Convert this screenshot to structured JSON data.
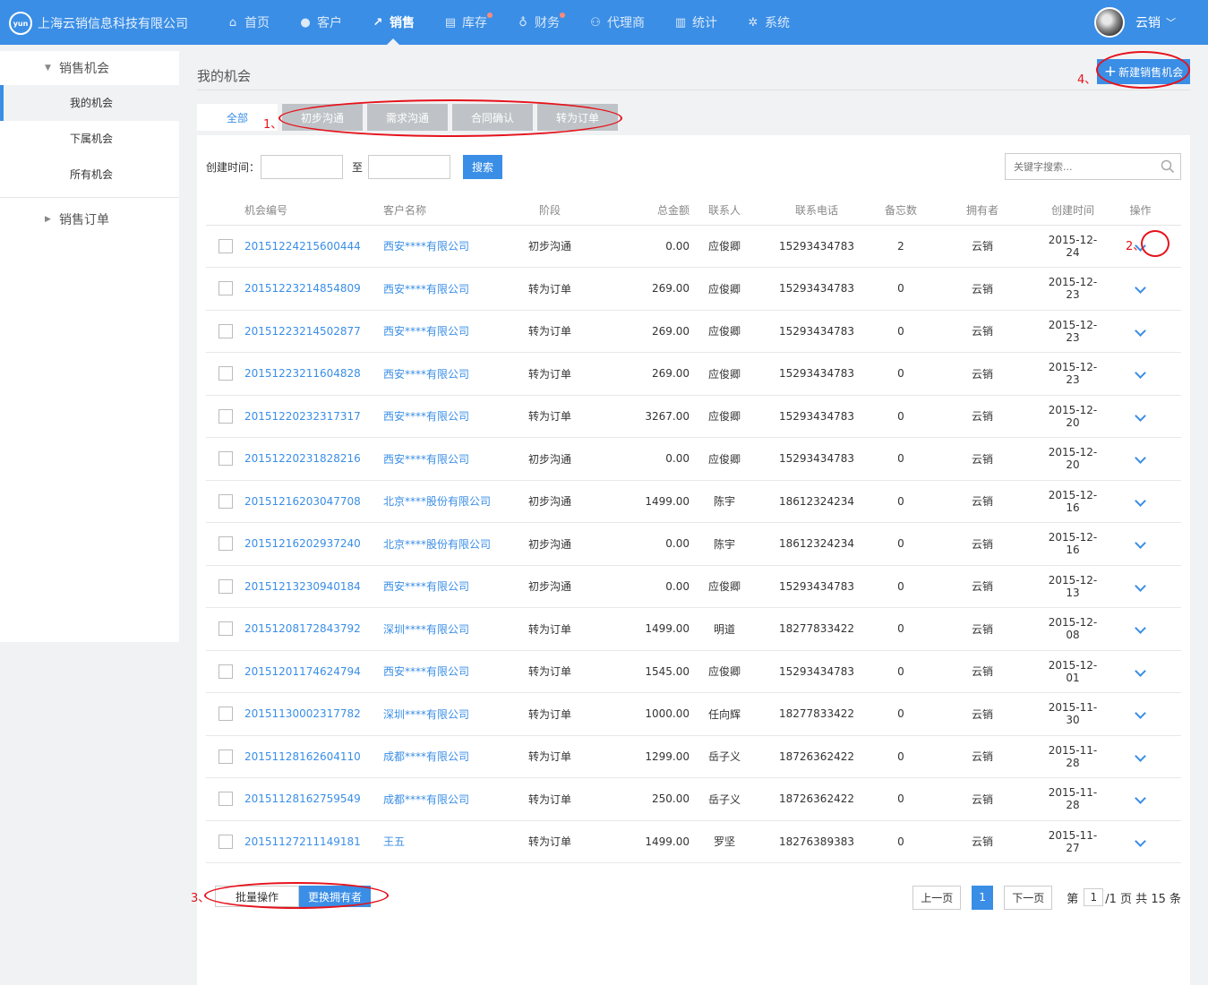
{
  "brand": {
    "logo": "yun",
    "name": "上海云销信息科技有限公司"
  },
  "nav": [
    {
      "label": "首页",
      "icon": "home-icon",
      "glyph": "⌂",
      "active": false,
      "dot": false
    },
    {
      "label": "客户",
      "icon": "person-icon",
      "glyph": "●",
      "active": false,
      "dot": false
    },
    {
      "label": "销售",
      "icon": "chart-icon",
      "glyph": "↗",
      "active": true,
      "dot": false
    },
    {
      "label": "库存",
      "icon": "warehouse-icon",
      "glyph": "▤",
      "active": false,
      "dot": true
    },
    {
      "label": "财务",
      "icon": "money-bag-icon",
      "glyph": "♁",
      "active": false,
      "dot": true
    },
    {
      "label": "代理商",
      "icon": "people-icon",
      "glyph": "⚇",
      "active": false,
      "dot": false
    },
    {
      "label": "统计",
      "icon": "bar-chart-icon",
      "glyph": "▥",
      "active": false,
      "dot": false
    },
    {
      "label": "系统",
      "icon": "gear-icon",
      "glyph": "✲",
      "active": false,
      "dot": false
    }
  ],
  "user": {
    "name": "云销"
  },
  "sidebar": {
    "group1": "销售机会",
    "items": [
      "我的机会",
      "下属机会",
      "所有机会"
    ],
    "group2": "销售订单"
  },
  "main": {
    "title": "我的机会",
    "new_button": "新建销售机会",
    "tabs": [
      "全部",
      "初步沟通",
      "需求沟通",
      "合同确认",
      "转为订单"
    ],
    "filter_label": "创建时间：",
    "to_label": "至",
    "search_button": "搜索",
    "keyword_placeholder": "关键字搜索..."
  },
  "table": {
    "headers": [
      "机会编号",
      "客户名称",
      "阶段",
      "总金额",
      "联系人",
      "联系电话",
      "备忘数",
      "拥有者",
      "创建时间",
      "操作"
    ],
    "rows": [
      [
        "20151224215600444",
        "西安****有限公司",
        "初步沟通",
        "0.00",
        "应俊卿",
        "15293434783",
        "2",
        "云销",
        "2015-12-24"
      ],
      [
        "20151223214854809",
        "西安****有限公司",
        "转为订单",
        "269.00",
        "应俊卿",
        "15293434783",
        "0",
        "云销",
        "2015-12-23"
      ],
      [
        "20151223214502877",
        "西安****有限公司",
        "转为订单",
        "269.00",
        "应俊卿",
        "15293434783",
        "0",
        "云销",
        "2015-12-23"
      ],
      [
        "20151223211604828",
        "西安****有限公司",
        "转为订单",
        "269.00",
        "应俊卿",
        "15293434783",
        "0",
        "云销",
        "2015-12-23"
      ],
      [
        "20151220232317317",
        "西安****有限公司",
        "转为订单",
        "3267.00",
        "应俊卿",
        "15293434783",
        "0",
        "云销",
        "2015-12-20"
      ],
      [
        "20151220231828216",
        "西安****有限公司",
        "初步沟通",
        "0.00",
        "应俊卿",
        "15293434783",
        "0",
        "云销",
        "2015-12-20"
      ],
      [
        "20151216203047708",
        "北京****股份有限公司",
        "初步沟通",
        "1499.00",
        "陈宇",
        "18612324234",
        "0",
        "云销",
        "2015-12-16"
      ],
      [
        "20151216202937240",
        "北京****股份有限公司",
        "初步沟通",
        "0.00",
        "陈宇",
        "18612324234",
        "0",
        "云销",
        "2015-12-16"
      ],
      [
        "20151213230940184",
        "西安****有限公司",
        "初步沟通",
        "0.00",
        "应俊卿",
        "15293434783",
        "0",
        "云销",
        "2015-12-13"
      ],
      [
        "20151208172843792",
        "深圳****有限公司",
        "转为订单",
        "1499.00",
        "明道",
        "18277833422",
        "0",
        "云销",
        "2015-12-08"
      ],
      [
        "20151201174624794",
        "西安****有限公司",
        "转为订单",
        "1545.00",
        "应俊卿",
        "15293434783",
        "0",
        "云销",
        "2015-12-01"
      ],
      [
        "20151130002317782",
        "深圳****有限公司",
        "转为订单",
        "1000.00",
        "任向辉",
        "18277833422",
        "0",
        "云销",
        "2015-11-30"
      ],
      [
        "20151128162604110",
        "成都****有限公司",
        "转为订单",
        "1299.00",
        "岳子义",
        "18726362422",
        "0",
        "云销",
        "2015-11-28"
      ],
      [
        "20151128162759549",
        "成都****有限公司",
        "转为订单",
        "250.00",
        "岳子义",
        "18726362422",
        "0",
        "云销",
        "2015-11-28"
      ],
      [
        "20151127211149181",
        "王五",
        "转为订单",
        "1499.00",
        "罗坚",
        "18276389383",
        "0",
        "云销",
        "2015-11-27"
      ]
    ]
  },
  "bottom": {
    "batch_label": "批量操作",
    "change_owner": "更换拥有者",
    "prev": "上一页",
    "current_page": "1",
    "next": "下一页",
    "page_prefix": "第",
    "page_input": "1",
    "page_suffix": "/1 页 共 15 条"
  },
  "annotations": [
    "1、",
    "2、",
    "3、",
    "4、"
  ],
  "colors": {
    "primary": "#3a8ee6",
    "annotation": "#e6121b",
    "tab_inactive": "#bfc3c7"
  }
}
